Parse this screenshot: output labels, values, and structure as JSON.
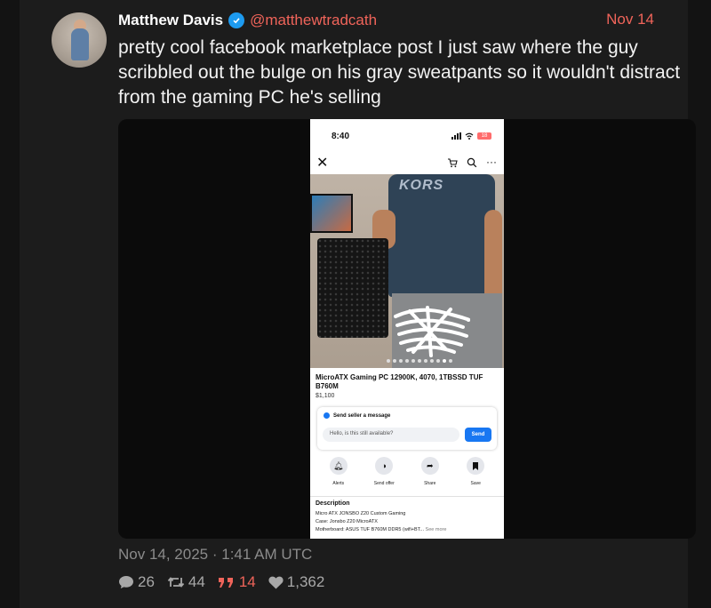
{
  "author": {
    "display_name": "Matthew Davis",
    "handle": "@matthewtradcath",
    "verified_icon": "verified-badge-icon",
    "avatar": "avatar"
  },
  "post": {
    "date_short": "Nov 14",
    "text": "pretty cool facebook marketplace post I just saw where the guy scribbled out the bulge on his gray sweatpants so it wouldn't distract from the gaming PC he's selling",
    "timestamp": "Nov 14, 2025 · 1:41 AM UTC"
  },
  "screenshot": {
    "time": "8:40",
    "battery": "18",
    "shirt_logo": "KORS",
    "listing_title": "MicroATX Gaming PC 12900K, 4070, 1TBSSD TUF B760M",
    "price": "$1,100",
    "message_heading": "Send seller a message",
    "message_value": "Hello, is this still available?",
    "send_label": "Send",
    "actions": [
      {
        "label": "Alerts",
        "icon": "bell-icon"
      },
      {
        "label": "Send offer",
        "icon": "offer-icon"
      },
      {
        "label": "Share",
        "icon": "share-icon"
      },
      {
        "label": "Save",
        "icon": "bookmark-icon"
      }
    ],
    "description_heading": "Description",
    "description_lines": [
      "Micro ATX JONSBO Z20 Custom Gaming",
      "Case: Jonsbo Z20 MicroATX",
      "Motherboard: ASUS TUF B760M DDR5 (wifi+BT..."
    ],
    "see_more": "See more"
  },
  "stats": {
    "replies": "26",
    "retweets": "44",
    "quotes": "14",
    "likes": "1,362"
  },
  "colors": {
    "accent": "#f0645a",
    "background": "#1c1c1c",
    "verified": "#1d9bf0",
    "facebook_blue": "#1877f2"
  }
}
